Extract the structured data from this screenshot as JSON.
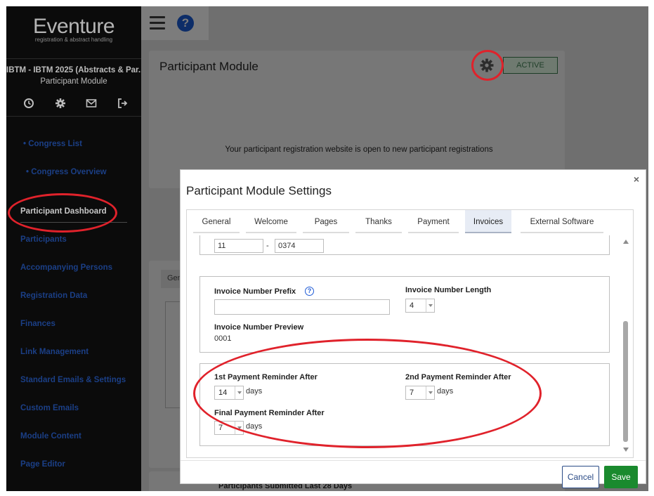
{
  "sidebar": {
    "logo_title": "Eventure",
    "logo_subtitle": "registration & abstract handling",
    "congress_title": "IBTM - IBTM 2025 (Abstracts & Par...",
    "module_name": "Participant Module",
    "icons": [
      "clock-icon",
      "gear-icon",
      "mail-icon",
      "sign-out-icon"
    ],
    "links": {
      "congress_list": "• Congress List",
      "congress_overview": "• Congress Overview",
      "participant_dashboard": "Participant Dashboard",
      "participants": "Participants",
      "accompanying_persons": "Accompanying Persons",
      "registration_data": "Registration Data",
      "finances": "Finances",
      "link_management": "Link Management",
      "standard_emails": "Standard Emails & Settings",
      "custom_emails": "Custom Emails",
      "module_content": "Module Content",
      "page_editor": "Page Editor"
    }
  },
  "topbar": {
    "icons": [
      "hamburger-menu-icon",
      "help-icon"
    ],
    "help_glyph": "?"
  },
  "main": {
    "title": "Participant Module",
    "status": "ACTIVE",
    "open_message": "Your participant registration website is open to new participant registrations",
    "tab_partial": "Gen",
    "submitted_label": "Participants Submitted Last 28 Days"
  },
  "modal": {
    "title": "Participant Module Settings",
    "close_glyph": "×",
    "tabs": [
      {
        "label": "General"
      },
      {
        "label": "Welcome"
      },
      {
        "label": "Pages"
      },
      {
        "label": "Thanks"
      },
      {
        "label": "Payment"
      },
      {
        "label": "Invoices"
      },
      {
        "label": "External Software"
      }
    ],
    "selected_tab": "Invoices",
    "top_field_a": "11",
    "top_sep": "-",
    "top_field_b": "0374",
    "invoice": {
      "prefix_label": "Invoice Number Prefix",
      "prefix_value": "",
      "help_glyph": "?",
      "length_label": "Invoice Number Length",
      "length_value": "4",
      "preview_label": "Invoice Number Preview",
      "preview_value": "0001"
    },
    "reminders": {
      "first_label": "1st Payment Reminder After",
      "first_value": "14",
      "second_label": "2nd Payment Reminder After",
      "second_value": "7",
      "final_label": "Final Payment Reminder After",
      "final_value": "7",
      "unit": "days"
    },
    "cancel_label": "Cancel",
    "save_label": "Save"
  },
  "annotation_color": "#e0222b"
}
